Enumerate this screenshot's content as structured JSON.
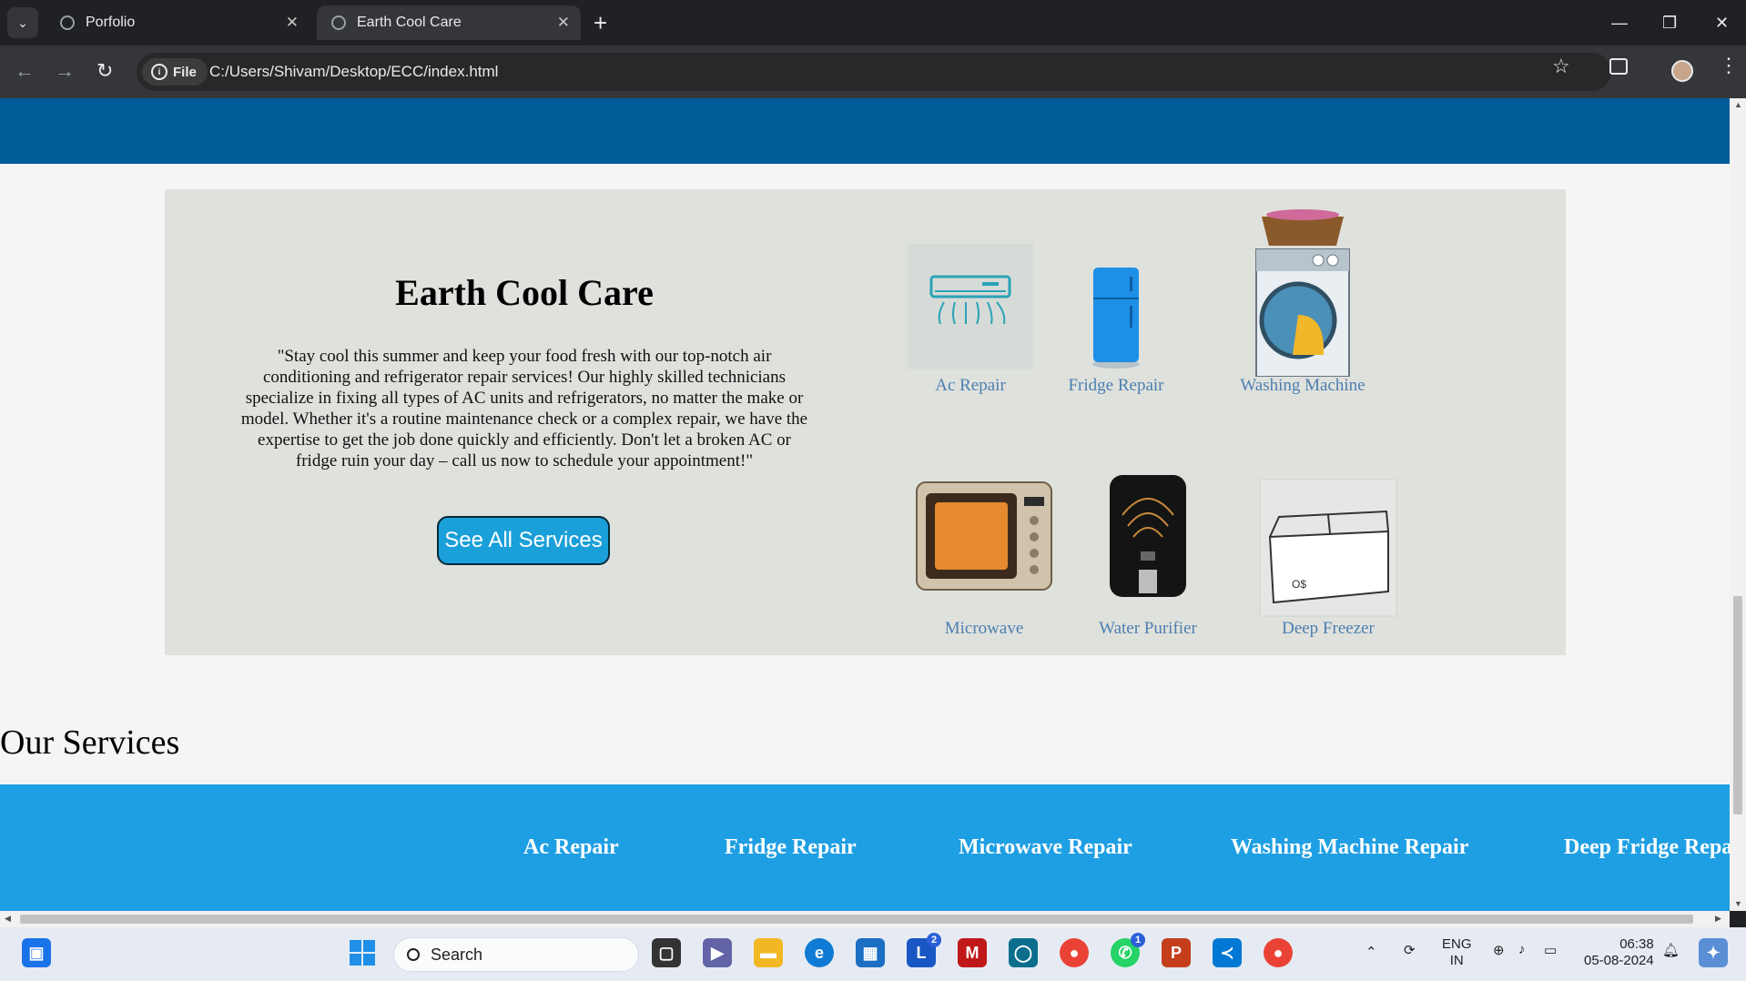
{
  "browser": {
    "tabs": [
      {
        "title": "Porfolio",
        "active": false
      },
      {
        "title": "Earth Cool Care",
        "active": true
      }
    ],
    "address": {
      "scheme_chip": "File",
      "url": "C:/Users/Shivam/Desktop/ECC/index.html"
    }
  },
  "hero": {
    "title": "Earth Cool Care",
    "description": "\"Stay cool this summer and keep your food fresh with our top-notch air conditioning and refrigerator repair services! Our highly skilled technicians specialize in fixing all types of AC units and refrigerators, no matter the make or model. Whether it's a routine maintenance check or a complex repair, we have the expertise to get the job done quickly and efficiently. Don't let a broken AC or fridge ruin your day – call us now to schedule your appointment!\"",
    "cta_label": "See All Services",
    "services": [
      {
        "label": "Ac Repair",
        "icon": "air-conditioner-icon"
      },
      {
        "label": "Fridge Repair",
        "icon": "fridge-icon"
      },
      {
        "label": "Washing Machine",
        "icon": "washing-machine-icon"
      },
      {
        "label": "Microwave",
        "icon": "microwave-icon"
      },
      {
        "label": "Water Purifier",
        "icon": "water-purifier-icon"
      },
      {
        "label": "Deep Freezer",
        "icon": "deep-freezer-icon"
      }
    ]
  },
  "services_section": {
    "title": "Our Services",
    "items": [
      "Ac Repair",
      "Fridge Repair",
      "Microwave Repair",
      "Washing Machine Repair",
      "Deep Fridge Repa"
    ]
  },
  "taskbar": {
    "search_placeholder": "Search",
    "badges": {
      "l_app": "2",
      "whatsapp": "1"
    },
    "lang": "ENG",
    "region": "IN",
    "time": "06:38",
    "date": "05-08-2024"
  },
  "colors": {
    "top_band": "#005b99",
    "hero_bg": "#dfe1dd",
    "cta_bg": "#1a9fd8",
    "service_bar": "#1f9fe3",
    "link": "#4c7fb0"
  }
}
